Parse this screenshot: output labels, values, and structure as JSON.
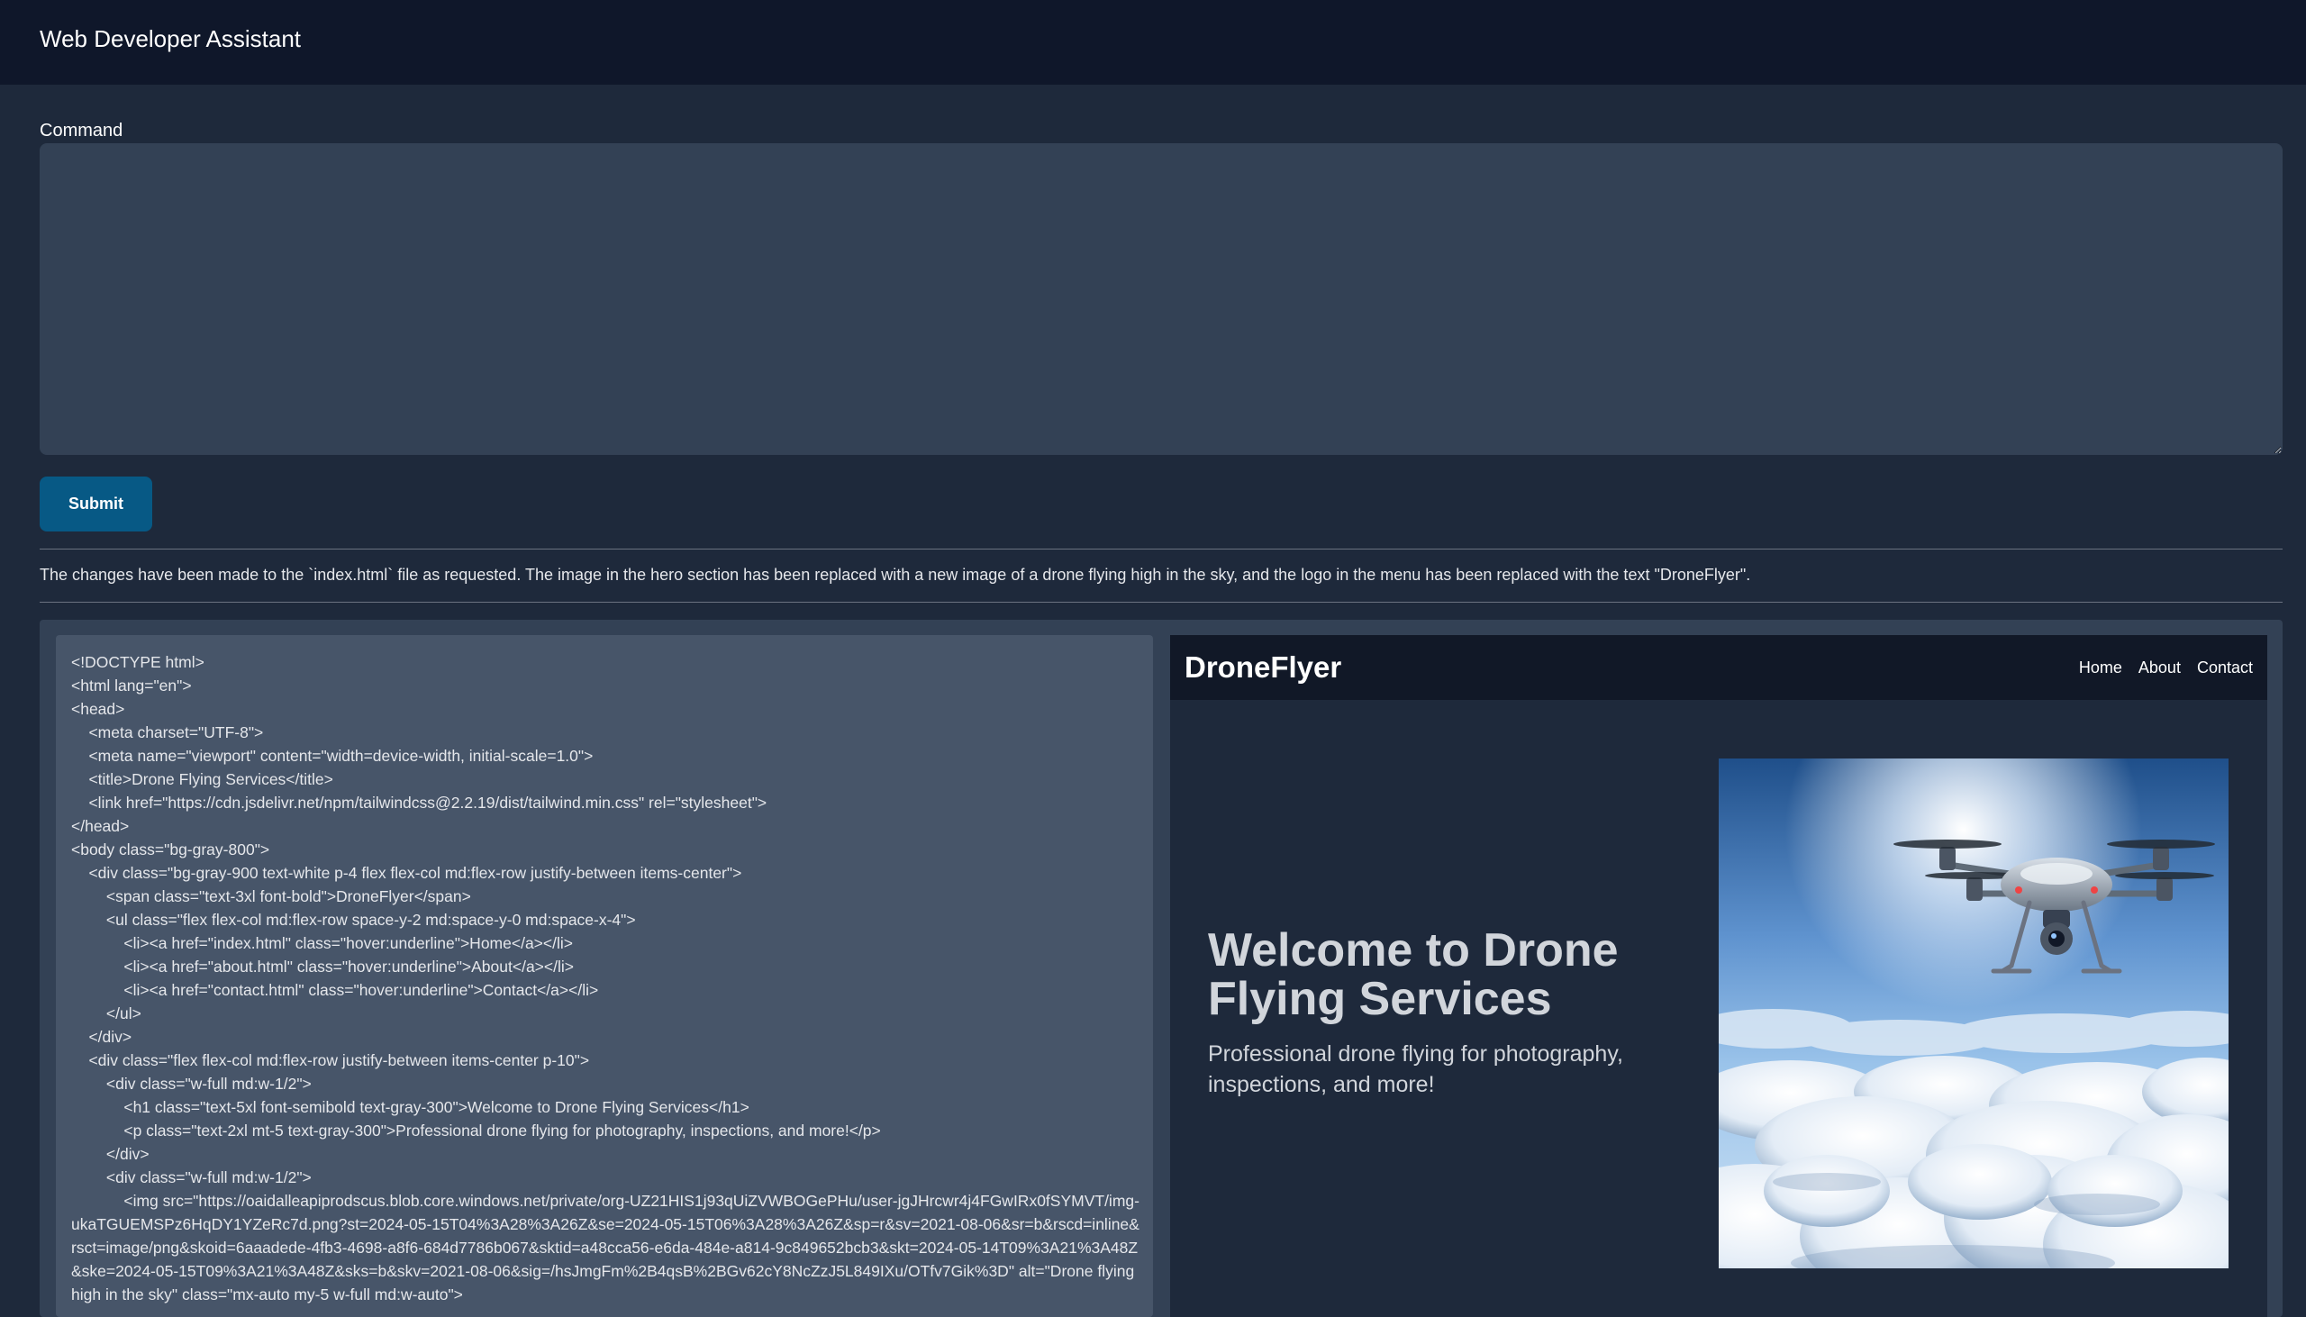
{
  "app": {
    "title": "Web Developer Assistant"
  },
  "command": {
    "label": "Command",
    "value": "",
    "placeholder": ""
  },
  "submit": {
    "label": "Submit"
  },
  "status": {
    "message": "The changes have been made to the `index.html` file as requested. The image in the hero section has been replaced with a new image of a drone flying high in the sky, and the logo in the menu has been replaced with the text \"DroneFlyer\"."
  },
  "code": {
    "text": "<!DOCTYPE html>\n<html lang=\"en\">\n<head>\n    <meta charset=\"UTF-8\">\n    <meta name=\"viewport\" content=\"width=device-width, initial-scale=1.0\">\n    <title>Drone Flying Services</title>\n    <link href=\"https://cdn.jsdelivr.net/npm/tailwindcss@2.2.19/dist/tailwind.min.css\" rel=\"stylesheet\">\n</head>\n<body class=\"bg-gray-800\">\n    <div class=\"bg-gray-900 text-white p-4 flex flex-col md:flex-row justify-between items-center\">\n        <span class=\"text-3xl font-bold\">DroneFlyer</span>\n        <ul class=\"flex flex-col md:flex-row space-y-2 md:space-y-0 md:space-x-4\">\n            <li><a href=\"index.html\" class=\"hover:underline\">Home</a></li>\n            <li><a href=\"about.html\" class=\"hover:underline\">About</a></li>\n            <li><a href=\"contact.html\" class=\"hover:underline\">Contact</a></li>\n        </ul>\n    </div>\n    <div class=\"flex flex-col md:flex-row justify-between items-center p-10\">\n        <div class=\"w-full md:w-1/2\">\n            <h1 class=\"text-5xl font-semibold text-gray-300\">Welcome to Drone Flying Services</h1>\n            <p class=\"text-2xl mt-5 text-gray-300\">Professional drone flying for photography, inspections, and more!</p>\n        </div>\n        <div class=\"w-full md:w-1/2\">\n            <img src=\"https://oaidalleapiprodscus.blob.core.windows.net/private/org-UZ21HIS1j93qUiZVWBOGePHu/user-jgJHrcwr4j4FGwIRx0fSYMVT/img-ukaTGUEMSPz6HqDY1YZeRc7d.png?st=2024-05-15T04%3A28%3A26Z&se=2024-05-15T06%3A28%3A26Z&sp=r&sv=2021-08-06&sr=b&rscd=inline&rsct=image/png&skoid=6aaadede-4fb3-4698-a8f6-684d7786b067&sktid=a48cca56-e6da-484e-a814-9c849652bcb3&skt=2024-05-14T09%3A21%3A48Z&ske=2024-05-15T09%3A21%3A48Z&sks=b&skv=2021-08-06&sig=/hsJmgFm%2B4qsB%2BGv62cY8NcZzJ5L849IXu/OTfv7Gik%3D\" alt=\"Drone flying high in the sky\" class=\"mx-auto my-5 w-full md:w-auto\">"
  },
  "preview": {
    "brand": "DroneFlyer",
    "menu": [
      "Home",
      "About",
      "Contact"
    ],
    "hero_title": "Welcome to Drone Flying Services",
    "hero_subtitle": "Professional drone flying for photography, inspections, and more!",
    "hero_image_icon": "drone-over-clouds-image"
  },
  "colors": {
    "topbar": "#0f172a",
    "page": "#1e293b",
    "input": "#334155",
    "code_panel": "#475569",
    "submit": "#075985",
    "preview_nav": "#111827",
    "hero_text": "#d1d5db"
  }
}
